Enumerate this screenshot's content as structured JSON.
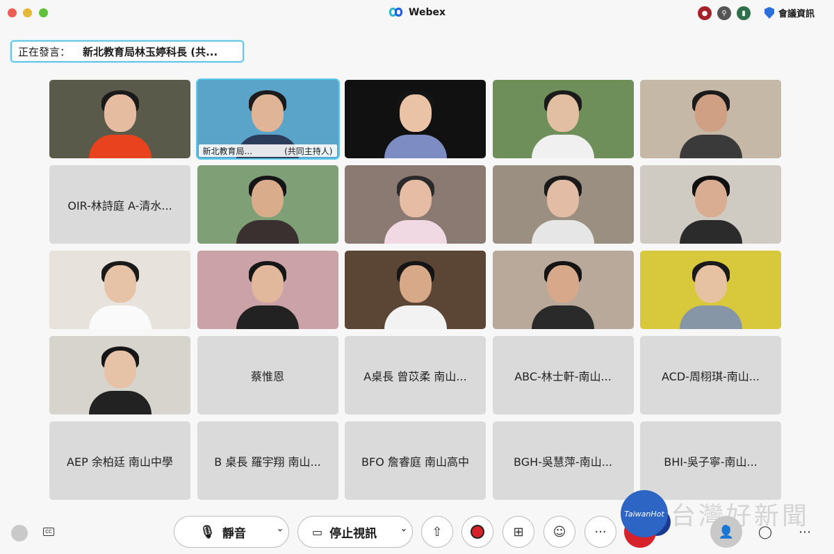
{
  "window": {
    "title": "Webex",
    "meeting_info": "會議資訊"
  },
  "speaker": {
    "label": "正在發言：",
    "name": "新北教育局林玉婷科長 (共..."
  },
  "tiles": [
    {
      "type": "video",
      "bg": "#5a5a4a",
      "shirt": "#e8421f",
      "hair": "#1a1a1a",
      "skin": "#e6bca0"
    },
    {
      "type": "video",
      "bg": "#5aa3c9",
      "shirt": "#2b3c5a",
      "hair": "#1b1b1b",
      "skin": "#e0b496",
      "active": true,
      "caption_name": "新北教育局...",
      "caption_role": "(共同主持人)"
    },
    {
      "type": "video",
      "bg": "#111111",
      "shirt": "#7d8dc4",
      "hair": "#151515",
      "skin": "#eac3a6"
    },
    {
      "type": "video",
      "bg": "#6e8f5a",
      "shirt": "#f0f0f0",
      "hair": "#1b1b1b",
      "skin": "#e2bea3"
    },
    {
      "type": "video",
      "bg": "#c5b8a6",
      "shirt": "#3a3a3a",
      "hair": "#1b1b1b",
      "skin": "#cfa084"
    },
    {
      "type": "name",
      "name": "OIR-林詩庭 A-清水..."
    },
    {
      "type": "video",
      "bg": "#7fa076",
      "shirt": "#3b3030",
      "hair": "#151515",
      "skin": "#d9ad8c"
    },
    {
      "type": "video",
      "bg": "#8a7a72",
      "shirt": "#f1d9e3",
      "hair": "#2a2a2a",
      "skin": "#e6bca4"
    },
    {
      "type": "video",
      "bg": "#9a8f80",
      "shirt": "#e6e6e6",
      "hair": "#1a1a1a",
      "skin": "#e2bca4"
    },
    {
      "type": "video",
      "bg": "#cfcbc2",
      "shirt": "#2b2b2b",
      "hair": "#101010",
      "skin": "#d8ad92"
    },
    {
      "type": "video",
      "bg": "#e7e3dc",
      "shirt": "#fafafa",
      "hair": "#1a1a1a",
      "skin": "#e6c2a6"
    },
    {
      "type": "video",
      "bg": "#caa2a8",
      "shirt": "#222222",
      "hair": "#161616",
      "skin": "#e2b89c"
    },
    {
      "type": "video",
      "bg": "#5b4636",
      "shirt": "#f2f2f2",
      "hair": "#151515",
      "skin": "#d8a988"
    },
    {
      "type": "video",
      "bg": "#b9a99b",
      "shirt": "#2a2a2a",
      "hair": "#141414",
      "skin": "#d8a88a"
    },
    {
      "type": "video",
      "bg": "#d8c83c",
      "shirt": "#8796a6",
      "hair": "#1a1a1a",
      "skin": "#e6c2a2"
    },
    {
      "type": "video",
      "bg": "#d7d3cd",
      "shirt": "#222222",
      "hair": "#161616",
      "skin": "#e6c2a6"
    },
    {
      "type": "name",
      "name": "蔡惟恩"
    },
    {
      "type": "name",
      "name": "A桌長 曾苡柔 南山..."
    },
    {
      "type": "name",
      "name": "ABC-林士軒-南山..."
    },
    {
      "type": "name",
      "name": "ACD-周栩琪-南山..."
    },
    {
      "type": "name",
      "name": "AEP 余柏廷 南山中學"
    },
    {
      "type": "name",
      "name": "B 桌長 羅宇翔 南山..."
    },
    {
      "type": "name",
      "name": "BFO 詹睿庭 南山高中"
    },
    {
      "type": "name",
      "name": "BGH-吳慧萍-南山..."
    },
    {
      "type": "name",
      "name": "BHI-吳子寧-南山..."
    }
  ],
  "controls": {
    "mute_label": "靜音",
    "video_label": "停止視訊",
    "cc_label": "CC",
    "more_label": "···"
  },
  "watermark": {
    "logo_text": "TaiwanHot",
    "text": "台灣好新聞"
  }
}
